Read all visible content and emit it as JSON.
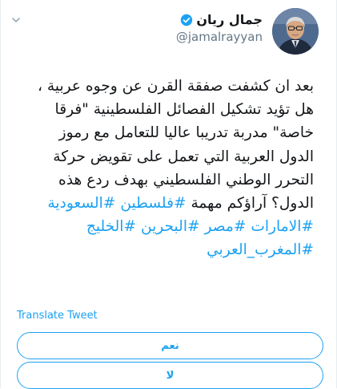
{
  "author": {
    "display_name": "جمال ريان",
    "handle": "@jamalrayyan",
    "verified": true,
    "avatar_icon": "profile-photo"
  },
  "tweet": {
    "lines": [
      [
        {
          "text": "بعد ان كشفت صفقة القرن عن وجوه عربية ،",
          "hashtag": false
        }
      ],
      [
        {
          "text": "هل تؤيد تشكيل الفصائل الفلسطينية \"فرقا",
          "hashtag": false
        }
      ],
      [
        {
          "text": "خاصة\" مدربة تدريبا عاليا للتعامل مع رموز",
          "hashtag": false
        }
      ],
      [
        {
          "text": "الدول العربية التي تعمل على تقويض حركة",
          "hashtag": false
        }
      ],
      [
        {
          "text": "التحرر الوطني الفلسطيني بهدف ردع هذه",
          "hashtag": false
        }
      ],
      [
        {
          "text": "الدول؟ آراؤكم مهمة ",
          "hashtag": false
        },
        {
          "text": "#فلسطين",
          "hashtag": true
        },
        {
          "text": " ",
          "hashtag": false
        },
        {
          "text": "#السعودية",
          "hashtag": true
        }
      ],
      [
        {
          "text": "#الامارات",
          "hashtag": true
        },
        {
          "text": " ",
          "hashtag": false
        },
        {
          "text": "#مصر",
          "hashtag": true
        },
        {
          "text": " ",
          "hashtag": false
        },
        {
          "text": "#البحرين",
          "hashtag": true
        },
        {
          "text": " ",
          "hashtag": false
        },
        {
          "text": "#الخليج",
          "hashtag": true
        }
      ],
      [
        {
          "text": "#المغرب_العربي",
          "hashtag": true
        }
      ]
    ]
  },
  "translate_label": "Translate Tweet",
  "poll": {
    "options": [
      "نعم",
      "لا"
    ]
  },
  "colors": {
    "accent": "#1da1f2",
    "text": "#14171a",
    "secondary": "#657786"
  },
  "icons": {
    "menu": "chevron-down-icon",
    "verified": "verified-badge-icon"
  }
}
